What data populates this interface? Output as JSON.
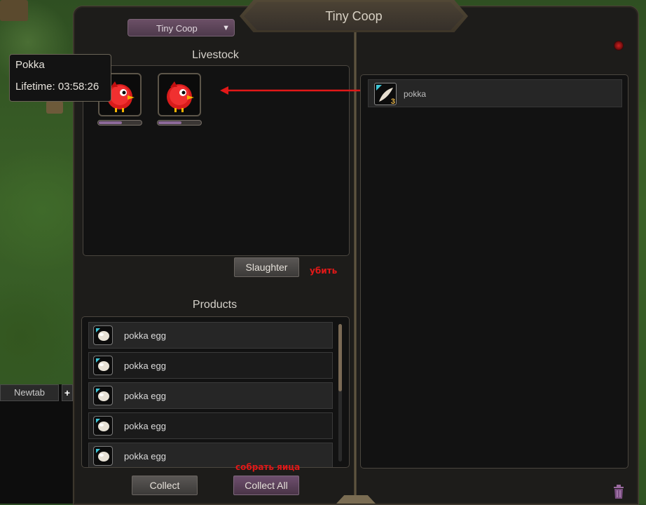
{
  "window": {
    "title": "Tiny Coop"
  },
  "building_select": {
    "value": "Tiny Coop"
  },
  "livestock": {
    "title": "Livestock",
    "animals": [
      {
        "name": "Pokka",
        "lifetime_fraction": 0.55,
        "icon": "red-bird-icon"
      },
      {
        "name": "Pokka",
        "lifetime_fraction": 0.55,
        "icon": "red-bird-icon"
      }
    ]
  },
  "tooltip": {
    "name": "Pokka",
    "lifetime": "Lifetime: 03:58:26"
  },
  "buttons": {
    "slaughter": "Slaughter",
    "collect": "Collect",
    "collect_all": "Collect All"
  },
  "annotations": {
    "slaughter_note": "убить",
    "collect_all_note": "собрать яица",
    "arrow_color": "#e21818"
  },
  "products": {
    "title": "Products",
    "items": [
      {
        "label": "pokka egg",
        "icon": "egg-icon"
      },
      {
        "label": "pokka egg",
        "icon": "egg-icon"
      },
      {
        "label": "pokka egg",
        "icon": "egg-icon"
      },
      {
        "label": "pokka egg",
        "icon": "egg-icon"
      },
      {
        "label": "pokka egg",
        "icon": "egg-icon"
      }
    ]
  },
  "inventory": {
    "items": [
      {
        "label": "pokka",
        "quantity": "3",
        "icon": "feather-icon"
      }
    ]
  },
  "chat": {
    "tab_label": "Newtab",
    "add_label": "+"
  },
  "colors": {
    "accent_purple": "#6e4f6e",
    "panel_bg": "#121212",
    "frame": "#4b463f"
  }
}
